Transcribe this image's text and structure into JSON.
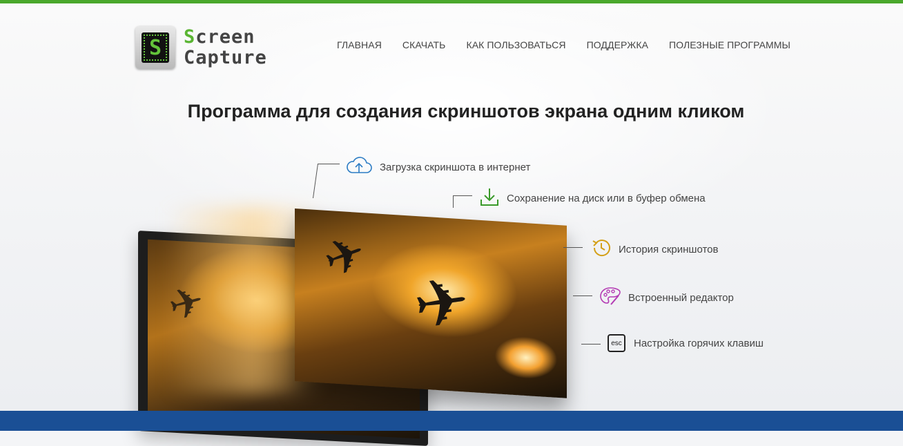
{
  "brand": {
    "logo_letter": "S",
    "name_line1_first": "S",
    "name_line1_rest": "creen",
    "name_line2": "Capture",
    "accent_green": "#4aa82c",
    "band_blue": "#1a4f95"
  },
  "nav": {
    "items": [
      {
        "label": "ГЛАВНАЯ"
      },
      {
        "label": "СКАЧАТЬ"
      },
      {
        "label": "КАК ПОЛЬЗОВАТЬСЯ"
      },
      {
        "label": "ПОДДЕРЖКА"
      },
      {
        "label": "ПОЛЕЗНЫЕ ПРОГРАММЫ"
      }
    ]
  },
  "hero": {
    "title": "Программа для создания скриншотов экрана одним кликом"
  },
  "features": [
    {
      "icon": "cloud-upload-icon",
      "label": "Загрузка скриншота в интернет",
      "color": "#2c7cc4"
    },
    {
      "icon": "download-icon",
      "label": "Сохранение на диск или в буфер обмена",
      "color": "#3a9a2a"
    },
    {
      "icon": "history-icon",
      "label": "История скриншотов",
      "color": "#d4a017"
    },
    {
      "icon": "palette-icon",
      "label": "Встроенный редактор",
      "color": "#b43cb4"
    },
    {
      "icon": "esc-key-icon",
      "label": "Настройка горячих клавиш",
      "key_label": "esc",
      "color": "#222222"
    }
  ]
}
